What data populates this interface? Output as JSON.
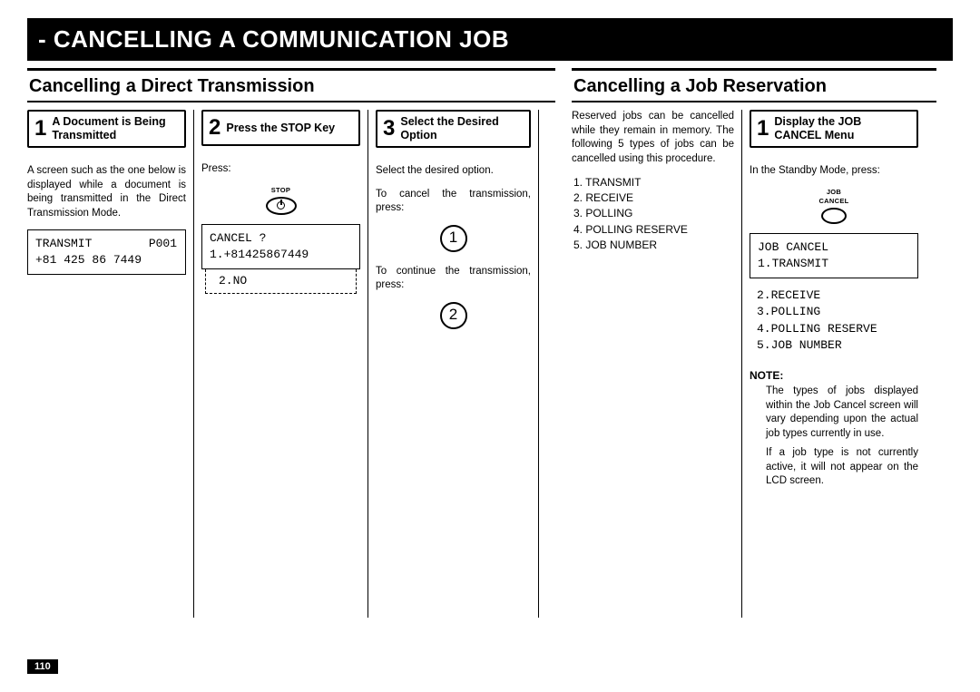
{
  "page_title": "- CANCELLING A COMMUNICATION JOB",
  "page_number": "110",
  "section_left": {
    "title": "Cancelling a Direct Transmission",
    "step1": {
      "num": "1",
      "title": "A Document is Being Transmitted",
      "body": "A screen such as the one below is displayed while a document is being transmitted in the Direct Transmission Mode.",
      "lcd": "TRANSMIT        P001\n+81 425 86 7449"
    },
    "step2": {
      "num": "2",
      "title": "Press the STOP Key",
      "body": "Press:",
      "key_label": "STOP",
      "lcd": "CANCEL ?\n1.+81425867449",
      "lcd_extra": "2.NO"
    },
    "step3": {
      "num": "3",
      "title": "Select the Desired Option",
      "body1": "Select the desired option.",
      "body2": "To cancel the transmission, press:",
      "circle1": "1",
      "body3": "To continue the transmission, press:",
      "circle2": "2"
    }
  },
  "section_right": {
    "title": "Cancelling a Job Reservation",
    "intro_col": {
      "body": "Reserved jobs can be cancelled while they remain in memory. The following 5 types of jobs can be cancelled using this procedure.",
      "list": {
        "i1": "1. TRANSMIT",
        "i2": "2. RECEIVE",
        "i3": "3. POLLING",
        "i4": "4. POLLING RESERVE",
        "i5": "5. JOB NUMBER"
      }
    },
    "step1": {
      "num": "1",
      "title": "Display the JOB CANCEL Menu",
      "body": "In the Standby Mode, press:",
      "key_label": "JOB CANCEL",
      "lcd": "JOB CANCEL\n1.TRANSMIT",
      "lcd_extra": "2.RECEIVE\n3.POLLING\n4.POLLING RESERVE\n5.JOB NUMBER",
      "note_head": "NOTE:",
      "note1": "The types of jobs displayed within the Job Cancel screen will vary depending upon the actual job types currently in use.",
      "note2": "If a job type is not currently active, it will not appear on the LCD screen."
    }
  }
}
